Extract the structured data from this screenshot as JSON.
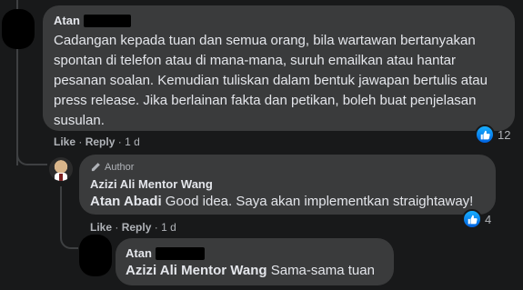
{
  "colors": {
    "background": "#18191a",
    "bubble": "#3a3b3c",
    "text": "#e4e6eb",
    "secondary_text": "#b0b3b8",
    "like_blue": "#0866ff"
  },
  "comments": [
    {
      "author": "Atan",
      "text": "Cadangan kepada tuan dan semua orang, bila wartawan bertanyakan spontan di telefon atau di mana-mana, suruh emailkan atau hantar pesanan soalan. Kemudian tuliskan dalam bentuk jawapan bertulis atau press release. Jika berlainan fakta dan petikan, boleh buat penjelasan susulan.",
      "like": "Like",
      "reply": "Reply",
      "time": "1 d",
      "reactions": "12"
    },
    {
      "badge": "Author",
      "author": "Azizi Ali Mentor Wang",
      "mention": "Atan Abadi",
      "text": "Good idea. Saya akan implementkan straightaway!",
      "like": "Like",
      "reply": "Reply",
      "time": "1 d",
      "reactions": "4"
    },
    {
      "author": "Atan",
      "mention": "Azizi Ali Mentor Wang",
      "text": "Sama-sama tuan"
    }
  ]
}
